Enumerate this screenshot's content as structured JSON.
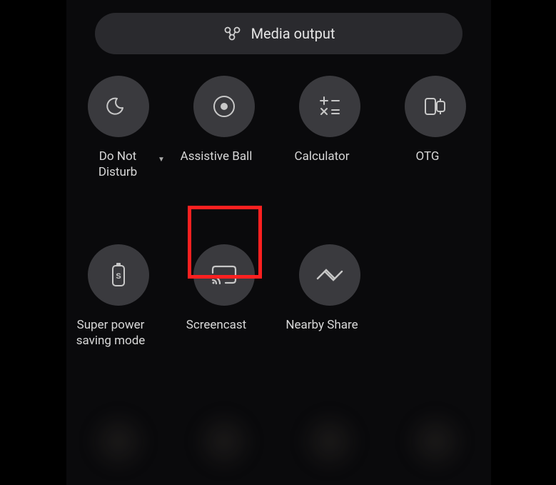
{
  "media_output": {
    "label": "Media output",
    "icon": "media-output-icon"
  },
  "tiles": [
    {
      "id": "do-not-disturb",
      "label": "Do Not Disturb",
      "icon": "moon-icon",
      "has_dropdown": true
    },
    {
      "id": "assistive-ball",
      "label": "Assistive Ball",
      "icon": "target-icon",
      "has_dropdown": false
    },
    {
      "id": "calculator",
      "label": "Calculator",
      "icon": "calculator-icon",
      "has_dropdown": false
    },
    {
      "id": "otg",
      "label": "OTG",
      "icon": "otg-icon",
      "has_dropdown": false
    },
    {
      "id": "super-power-saving",
      "label": "Super power saving mode",
      "icon": "battery-icon",
      "has_dropdown": false
    },
    {
      "id": "screencast",
      "label": "Screencast",
      "icon": "cast-icon",
      "has_dropdown": false,
      "highlighted": true
    },
    {
      "id": "nearby-share",
      "label": "Nearby Share",
      "icon": "nearby-share-icon",
      "has_dropdown": false
    }
  ],
  "colors": {
    "background": "#0a0a0c",
    "tile_bg": "#3a3a3e",
    "pill_bg": "#2a2a2e",
    "text": "#d8d8d8",
    "highlight": "#ff2020"
  }
}
